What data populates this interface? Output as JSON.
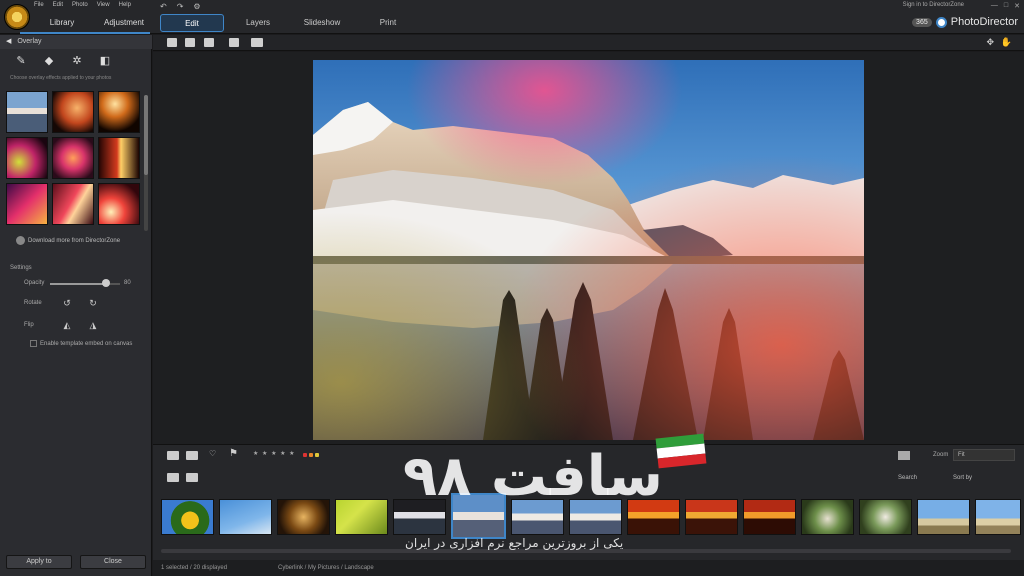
{
  "app": {
    "name": "PhotoDirector",
    "badge": "365",
    "sign_in": "Sign in to DirectorZone",
    "menus": [
      "File",
      "Edit",
      "Photo",
      "View",
      "Help"
    ]
  },
  "mode_tabs": {
    "library": "Library",
    "adjustment": "Adjustment"
  },
  "module_tabs": {
    "edit": "Edit",
    "layers": "Layers",
    "slideshow": "Slideshow",
    "print": "Print"
  },
  "left_panel": {
    "title": "Overlay",
    "info": "Choose overlay effects applied to your photos",
    "manage_label": "Download more from DirectorZone",
    "settings_label": "Settings",
    "opacity_label": "Opacity",
    "opacity_value": "80",
    "opacity": 0.8,
    "rotate_label": "Rotate",
    "flip_label": "Flip",
    "checkbox_label": "Enable template embed on canvas",
    "apply_label": "Apply to",
    "close_label": "Close"
  },
  "filmstrip": {
    "zoom_label": "Zoom",
    "zoom_value": "Fit",
    "search_label": "Search",
    "sort_label": "Sort by",
    "rating": "★ ★ ★ ★ ★",
    "status_left": "1 selected / 20 displayed",
    "status_right": "Cyberlink / My Pictures / Landscape"
  },
  "watermark": {
    "logo_text": "سافت ۹۸",
    "tagline": "یکی از بروزترین مراجع نرم افزاری در ایران"
  },
  "icons": {
    "brush": "brush-icon",
    "shape": "shape-icon",
    "eraser": "eraser-icon",
    "mask": "mask-icon",
    "undo": "undo-icon",
    "redo": "redo-icon",
    "flag": "flag-icon",
    "favorite": "favorite-icon"
  },
  "colors": {
    "accent": "#3f86c8",
    "panel": "#2b2c30",
    "background": "#1b1b1d"
  }
}
